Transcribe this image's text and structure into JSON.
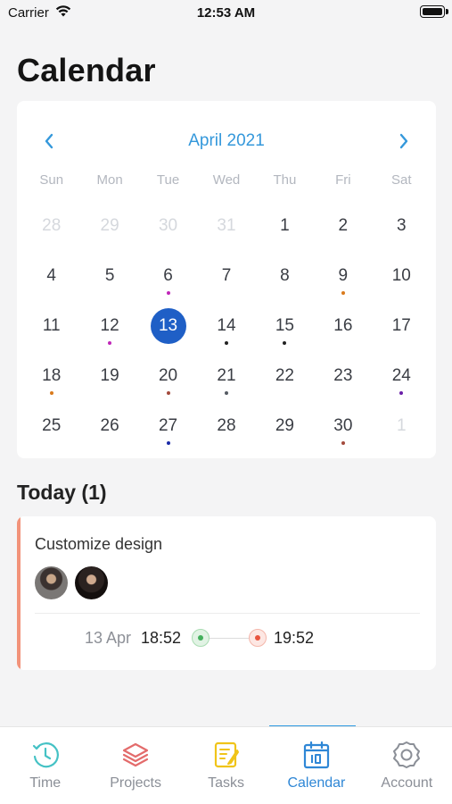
{
  "status_bar": {
    "carrier": "Carrier",
    "time": "12:53 AM"
  },
  "page": {
    "title": "Calendar"
  },
  "calendar": {
    "month_label": "April 2021",
    "weekdays": [
      "Sun",
      "Mon",
      "Tue",
      "Wed",
      "Thu",
      "Fri",
      "Sat"
    ],
    "days": [
      {
        "n": "28",
        "muted": true
      },
      {
        "n": "29",
        "muted": true
      },
      {
        "n": "30",
        "muted": true
      },
      {
        "n": "31",
        "muted": true
      },
      {
        "n": "1"
      },
      {
        "n": "2"
      },
      {
        "n": "3"
      },
      {
        "n": "4"
      },
      {
        "n": "5"
      },
      {
        "n": "6",
        "dot": "#c026b8"
      },
      {
        "n": "7"
      },
      {
        "n": "8"
      },
      {
        "n": "9",
        "dot": "#d97a1c"
      },
      {
        "n": "10"
      },
      {
        "n": "11"
      },
      {
        "n": "12",
        "dot": "#c026b8"
      },
      {
        "n": "13",
        "selected": true
      },
      {
        "n": "14",
        "dot": "#222222"
      },
      {
        "n": "15",
        "dot": "#222222"
      },
      {
        "n": "16"
      },
      {
        "n": "17"
      },
      {
        "n": "18",
        "dot": "#d97a1c"
      },
      {
        "n": "19"
      },
      {
        "n": "20",
        "dot": "#a34a3c"
      },
      {
        "n": "21",
        "dot": "#555b63"
      },
      {
        "n": "22"
      },
      {
        "n": "23"
      },
      {
        "n": "24",
        "dot": "#6a1fa8"
      },
      {
        "n": "25"
      },
      {
        "n": "26"
      },
      {
        "n": "27",
        "dot": "#1a2aa8"
      },
      {
        "n": "28"
      },
      {
        "n": "29"
      },
      {
        "n": "30",
        "dot": "#a34a3c"
      },
      {
        "n": "1",
        "muted": true
      }
    ]
  },
  "today": {
    "heading": "Today (1)",
    "event": {
      "title": "Customize design",
      "date": "13 Apr",
      "start": "18:52",
      "end": "19:52",
      "accent_color": "#f2937a"
    }
  },
  "tabs": [
    {
      "label": "Time",
      "icon": "clock-icon"
    },
    {
      "label": "Projects",
      "icon": "layers-icon"
    },
    {
      "label": "Tasks",
      "icon": "notepad-icon"
    },
    {
      "label": "Calendar",
      "icon": "calendar-icon",
      "active": true
    },
    {
      "label": "Account",
      "icon": "gear-icon"
    }
  ],
  "colors": {
    "accent": "#2f87d6",
    "selected_day": "#1f5fc6",
    "month_label": "#3498db"
  }
}
